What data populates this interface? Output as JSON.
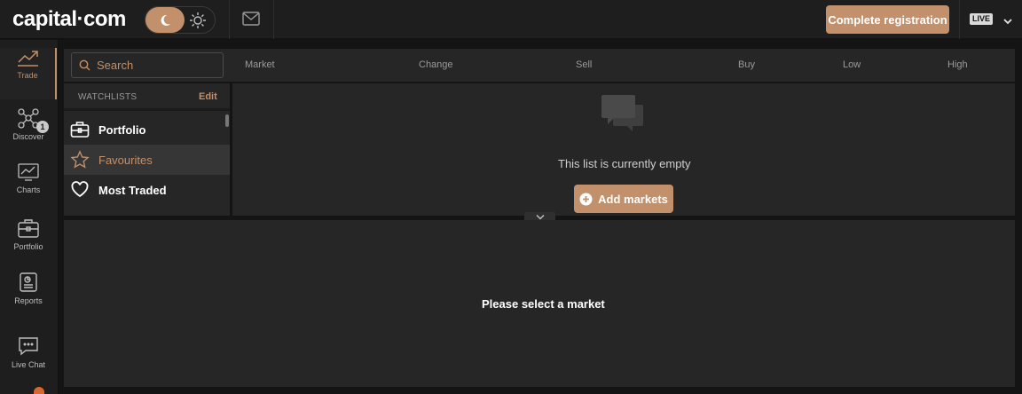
{
  "brand": {
    "logo_text": "capital·com",
    "accent_color": "#c2906a"
  },
  "header": {
    "theme_toggle": {
      "active": "dark",
      "dark_icon": "moon-icon",
      "light_icon": "sun-icon"
    },
    "mail_icon": "mail-icon",
    "cta_label": "Complete registration",
    "account_mode": "LIVE"
  },
  "sidebar": {
    "items": [
      {
        "label": "Trade",
        "icon": "trade-chart-icon",
        "active": true
      },
      {
        "label": "Discover",
        "icon": "network-icon"
      },
      {
        "label": "Charts",
        "icon": "charts-icon",
        "badge": "1"
      },
      {
        "label": "Portfolio",
        "icon": "briefcase-icon"
      },
      {
        "label": "Reports",
        "icon": "report-icon"
      },
      {
        "label": "Live Chat",
        "icon": "chat-icon"
      }
    ]
  },
  "search": {
    "placeholder": "Search"
  },
  "columns": [
    "Market",
    "Change",
    "Sell",
    "Buy",
    "Low",
    "High"
  ],
  "watchlists": {
    "title": "WATCHLISTS",
    "edit_label": "Edit",
    "items": [
      {
        "label": "Portfolio",
        "icon": "briefcase-icon"
      },
      {
        "label": "Favourites",
        "icon": "star-icon",
        "selected": true
      },
      {
        "label": "Most Traded",
        "icon": "heart-icon"
      }
    ]
  },
  "empty_state": {
    "icon": "chat-bubbles-icon",
    "text": "This list is currently empty",
    "button_label": "Add markets"
  },
  "details": {
    "placeholder_text": "Please select a market"
  }
}
